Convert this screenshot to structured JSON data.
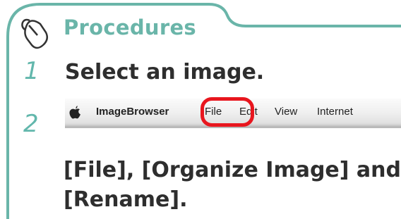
{
  "header": {
    "title": "Procedures",
    "icon": "mouse-icon"
  },
  "colors": {
    "accent": "#6ab5a9",
    "highlight": "#e8161e",
    "text": "#2e2e2e"
  },
  "steps": [
    {
      "number": "1",
      "text": "Select an image."
    },
    {
      "number": "2",
      "lines": [
        "[File], [Organize Image] and",
        "[Rename]."
      ]
    }
  ],
  "menubar": {
    "apple_icon": "apple-icon",
    "items": [
      "ImageBrowser",
      "File",
      "Edit",
      "View",
      "Internet"
    ],
    "highlighted_item": "File"
  }
}
